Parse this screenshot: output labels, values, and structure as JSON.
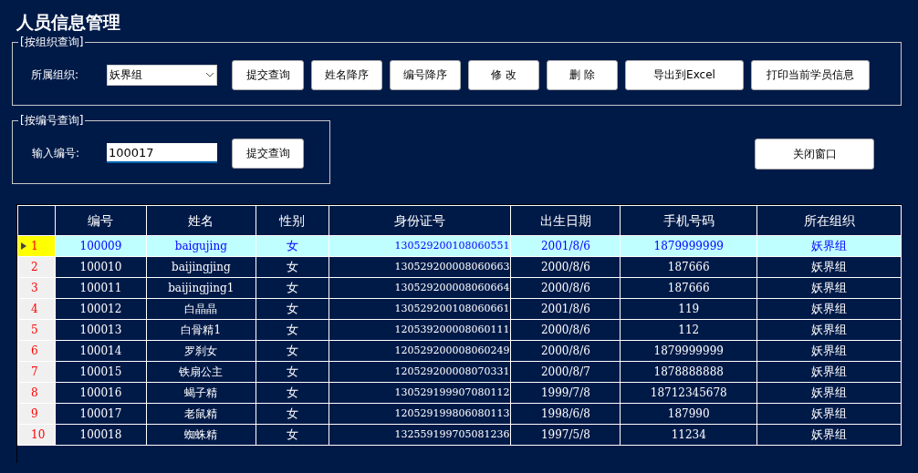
{
  "window": {
    "title": "人员信息管理"
  },
  "org_query": {
    "legend": "[按组织查询]",
    "label": "所属组织:",
    "combo": {
      "value": "妖界组"
    },
    "buttons": [
      "提交查询",
      "姓名降序",
      "编号降序",
      "修 改",
      "删 除",
      "导出到Excel",
      "打印当前学员信息"
    ]
  },
  "id_query": {
    "legend": "[按编号查询]",
    "label": "输入编号:",
    "input": {
      "value": "100017"
    },
    "button": "提交查询"
  },
  "close_button": "关闭窗口",
  "table": {
    "columns": [
      "编号",
      "姓名",
      "性别",
      "身份证号",
      "出生日期",
      "手机号码",
      "所在组织"
    ],
    "rows": [
      {
        "index": "1",
        "selected": true,
        "cells": [
          "100009",
          "baigujing",
          "女",
          "130529200108060551",
          "2001/8/6",
          "1879999999",
          "妖界组"
        ]
      },
      {
        "index": "2",
        "selected": false,
        "cells": [
          "100010",
          "baijingjing",
          "女",
          "130529200008060663",
          "2000/8/6",
          "187666",
          "妖界组"
        ]
      },
      {
        "index": "3",
        "selected": false,
        "cells": [
          "100011",
          "baijingjing1",
          "女",
          "130529200008060664",
          "2000/8/6",
          "187666",
          "妖界组"
        ]
      },
      {
        "index": "4",
        "selected": false,
        "cells": [
          "100012",
          "白晶晶",
          "女",
          "130529200108060661",
          "2001/8/6",
          "119",
          "妖界组"
        ]
      },
      {
        "index": "5",
        "selected": false,
        "cells": [
          "100013",
          "白骨精1",
          "女",
          "120539200008060111",
          "2000/8/6",
          "112",
          "妖界组"
        ]
      },
      {
        "index": "6",
        "selected": false,
        "cells": [
          "100014",
          "罗刹女",
          "女",
          "120529200008060249",
          "2000/8/6",
          "1879999999",
          "妖界组"
        ]
      },
      {
        "index": "7",
        "selected": false,
        "cells": [
          "100015",
          "铁扇公主",
          "女",
          "120529200008070331",
          "2000/8/7",
          "1878888888",
          "妖界组"
        ]
      },
      {
        "index": "8",
        "selected": false,
        "cells": [
          "100016",
          "蝎子精",
          "女",
          "130529199907080112",
          "1999/7/8",
          "18712345678",
          "妖界组"
        ]
      },
      {
        "index": "9",
        "selected": false,
        "cells": [
          "100017",
          "老鼠精",
          "女",
          "120529199806080113",
          "1998/6/8",
          "187990",
          "妖界组"
        ]
      },
      {
        "index": "10",
        "selected": false,
        "cells": [
          "100018",
          "蜘蛛精",
          "女",
          "132559199705081236",
          "1997/5/8",
          "11234",
          "妖界组"
        ]
      }
    ]
  }
}
